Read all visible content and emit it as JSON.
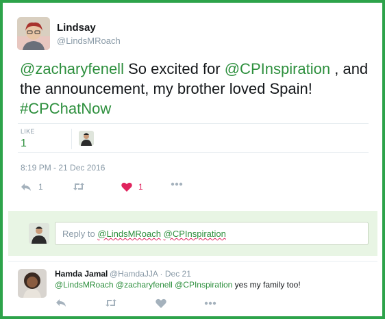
{
  "tweet": {
    "author_name": "Lindsay",
    "author_handle": "@LindsMRoach",
    "text_parts": {
      "mention1": "@zacharyfenell",
      "t1": " So excited for ",
      "mention2": "@CPInspiration",
      "t2": " , and the announcement, my brother loved Spain! ",
      "hashtag": "#CPChatNow"
    },
    "like_label": "LIKE",
    "like_count": "1",
    "timestamp": "8:19 PM - 21 Dec 2016",
    "actions": {
      "reply_count": "1",
      "like_count": "1"
    }
  },
  "reply_box": {
    "prefix": "Reply to ",
    "mention1": "@LindsMRoach",
    "mention2": "@CPInspiration"
  },
  "reply": {
    "author_name": "Hamda Jamal",
    "meta": "@HamdaJJA · Dec 21",
    "mentions": "@LindsMRoach @zacharyfenell @CPInspiration",
    "text": " yes my family too!"
  },
  "colors": {
    "border": "#2da34a",
    "link": "#2d8f3d",
    "heart": "#e0245e",
    "muted": "#8899a6"
  }
}
